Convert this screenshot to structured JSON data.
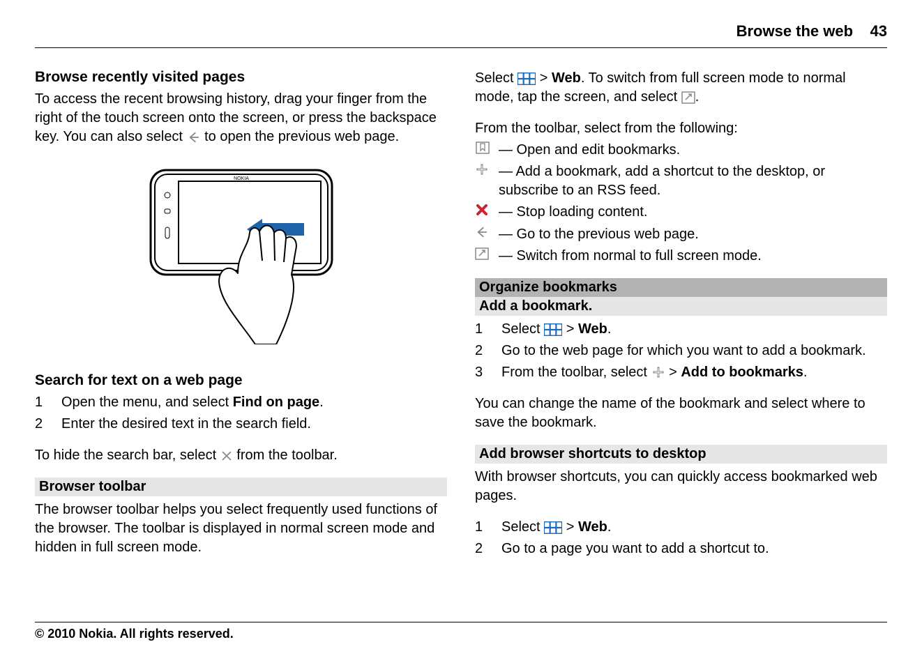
{
  "header": {
    "title": "Browse the web",
    "page_number": "43"
  },
  "left": {
    "s1": {
      "title": "Browse recently visited pages",
      "p1a": "To access the recent browsing history, drag your finger from the right of the touch screen onto the screen, or press the backspace key. You can also select ",
      "p1b": " to open the previous web page."
    },
    "s2": {
      "title": "Search for text on a web page",
      "step1_pre": "Open the menu, and select ",
      "step1_link": "Find on page",
      "step1_post": ".",
      "step2": "Enter the desired text in the search field.",
      "p_hide_a": "To hide the search bar, select ",
      "p_hide_b": " from the toolbar."
    },
    "s3": {
      "title": "Browser toolbar",
      "p": "The browser toolbar helps you select frequently used functions of the browser. The toolbar is displayed in normal screen mode and hidden in full screen mode."
    }
  },
  "right": {
    "intro": {
      "a": "Select ",
      "b": " > ",
      "web": "Web",
      "c": ". To switch from full screen mode to normal mode, tap the screen, and select ",
      "d": "."
    },
    "toolbar_intro": "From the toolbar, select from the following:",
    "items": [
      " — Open and edit bookmarks.",
      " — Add a bookmark, add a shortcut to the desktop, or subscribe to an RSS feed.",
      " — Stop loading content.",
      " — Go to the previous web page.",
      " — Switch from normal to full screen mode."
    ],
    "org_title": "Organize bookmarks",
    "add_title": "Add a bookmark.",
    "add_steps": {
      "s1a": "Select ",
      "s1b": " > ",
      "s1web": "Web",
      "s1c": ".",
      "s2": "Go to the web page for which you want to add a bookmark.",
      "s3a": "From the toolbar, select ",
      "s3b": " > ",
      "s3link": "Add to bookmarks",
      "s3c": "."
    },
    "change_p": "You can change the name of the bookmark and select where to save the bookmark.",
    "shortcuts_title": "Add browser shortcuts to desktop",
    "shortcuts_p": "With browser shortcuts, you can quickly access bookmarked web pages.",
    "shortcut_steps": {
      "s1a": "Select ",
      "s1b": " > ",
      "s1web": "Web",
      "s1c": ".",
      "s2": "Go to a page you want to add a shortcut to."
    }
  },
  "footer": "© 2010 Nokia. All rights reserved."
}
